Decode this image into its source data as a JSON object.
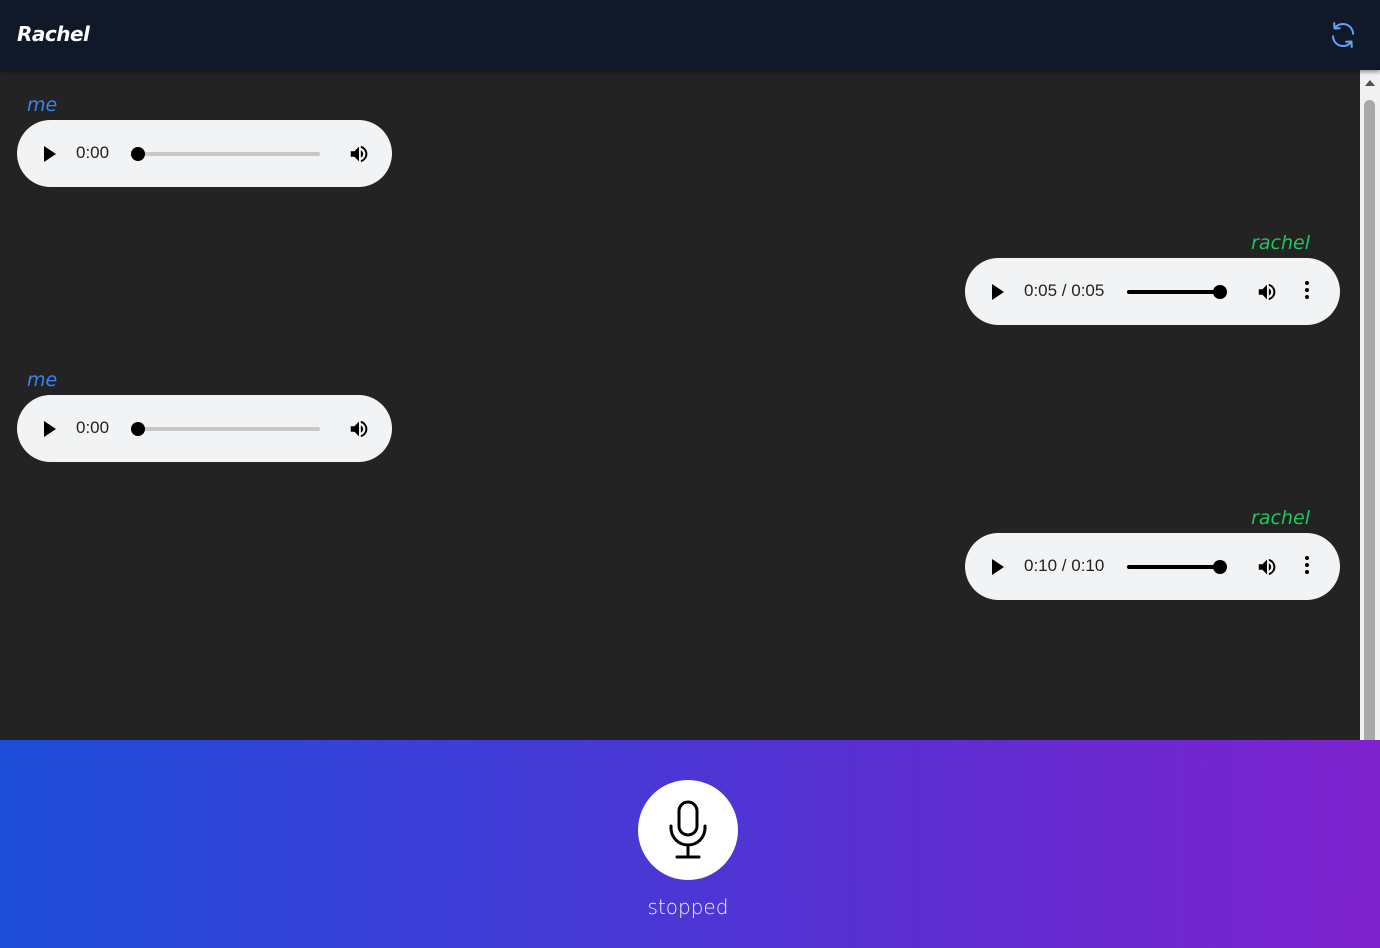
{
  "header": {
    "title": "Rachel",
    "refresh_icon": "refresh-icon"
  },
  "messages": [
    {
      "sender": "me",
      "time": "0:00",
      "progress": 0.0
    },
    {
      "sender": "rachel",
      "time": "0:05 / 0:05",
      "progress": 1.0
    },
    {
      "sender": "me",
      "time": "0:00",
      "progress": 0.0
    },
    {
      "sender": "rachel",
      "time": "0:10 / 0:10",
      "progress": 1.0
    }
  ],
  "recorder": {
    "mic_icon": "microphone-icon",
    "status": "stopped"
  },
  "colors": {
    "header_bg": "#111827",
    "chat_bg": "#232323",
    "me_label": "#3b82f6",
    "rachel_label": "#22c55e",
    "gradient_start": "#1d4ed8",
    "gradient_end": "#7e22ce"
  }
}
